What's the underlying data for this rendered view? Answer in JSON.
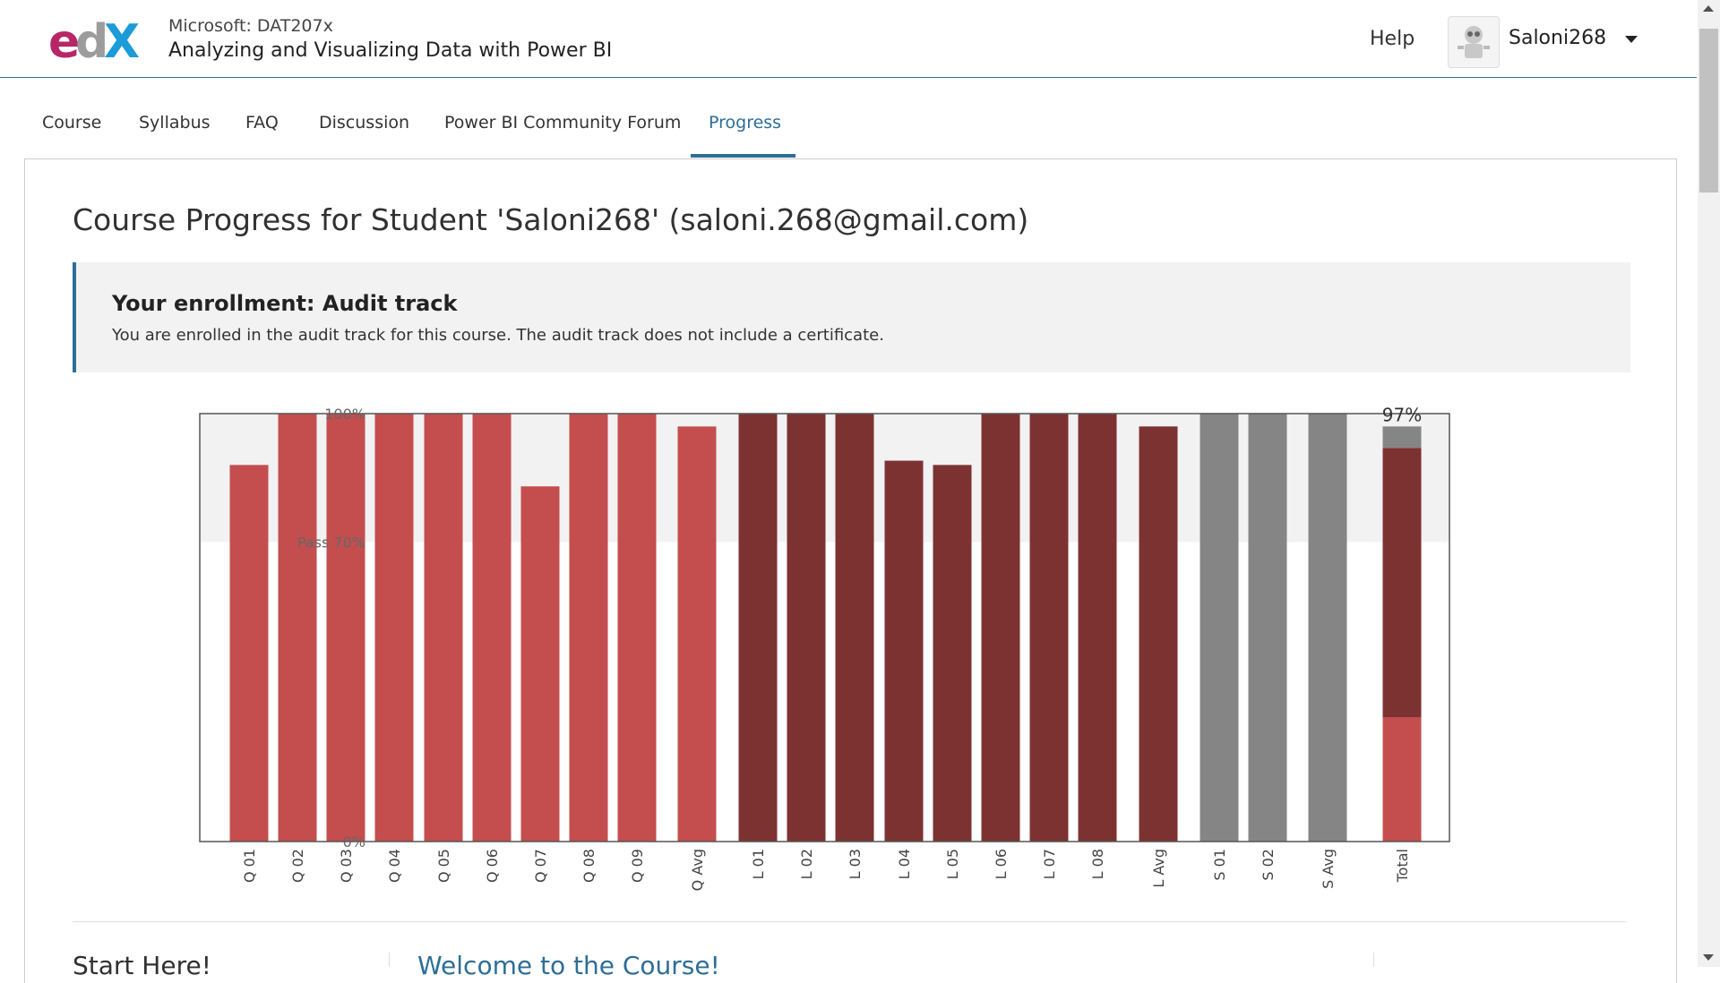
{
  "header": {
    "logo_text": "edX",
    "course_org": "Microsoft: DAT207x",
    "course_name": "Analyzing and Visualizing Data with Power BI",
    "help_label": "Help",
    "username": "Saloni268"
  },
  "tabs": [
    {
      "label": "Course"
    },
    {
      "label": "Syllabus"
    },
    {
      "label": "FAQ"
    },
    {
      "label": "Discussion"
    },
    {
      "label": "Power BI Community Forum"
    },
    {
      "label": "Progress",
      "active": true
    }
  ],
  "main": {
    "page_title": "Course Progress for Student 'Saloni268' (saloni.268@gmail.com)",
    "enrollment": {
      "title": "Your enrollment: Audit track",
      "text": "You are enrolled in the audit track for this course. The audit track does not include a certificate."
    },
    "sidebar_heading": "Start Here!",
    "welcome_link": "Welcome to the Course!"
  },
  "chart_data": {
    "type": "bar",
    "ylim": [
      0,
      100
    ],
    "pass_threshold": 70,
    "tick_labels": {
      "top": "100%",
      "pass": "Pass 70%",
      "bottom": "0%"
    },
    "total_label": "97%",
    "categories": [
      "Q 01",
      "Q 02",
      "Q 03",
      "Q 04",
      "Q 05",
      "Q 06",
      "Q 07",
      "Q 08",
      "Q 09",
      "Q Avg",
      "L 01",
      "L 02",
      "L 03",
      "L 04",
      "L 05",
      "L 06",
      "L 07",
      "L 08",
      "L Avg",
      "S 01",
      "S 02",
      "S Avg",
      "Total"
    ],
    "bars": [
      {
        "label": "Q 01",
        "value": 88,
        "group": "quiz"
      },
      {
        "label": "Q 02",
        "value": 100,
        "group": "quiz"
      },
      {
        "label": "Q 03",
        "value": 100,
        "group": "quiz"
      },
      {
        "label": "Q 04",
        "value": 100,
        "group": "quiz"
      },
      {
        "label": "Q 05",
        "value": 100,
        "group": "quiz"
      },
      {
        "label": "Q 06",
        "value": 100,
        "group": "quiz"
      },
      {
        "label": "Q 07",
        "value": 83,
        "group": "quiz"
      },
      {
        "label": "Q 08",
        "value": 100,
        "group": "quiz"
      },
      {
        "label": "Q 09",
        "value": 100,
        "group": "quiz"
      },
      {
        "label": "Q Avg",
        "value": 97,
        "group": "quiz"
      },
      {
        "label": "L 01",
        "value": 100,
        "group": "lab"
      },
      {
        "label": "L 02",
        "value": 100,
        "group": "lab"
      },
      {
        "label": "L 03",
        "value": 100,
        "group": "lab"
      },
      {
        "label": "L 04",
        "value": 89,
        "group": "lab"
      },
      {
        "label": "L 05",
        "value": 88,
        "group": "lab"
      },
      {
        "label": "L 06",
        "value": 100,
        "group": "lab"
      },
      {
        "label": "L 07",
        "value": 100,
        "group": "lab"
      },
      {
        "label": "L 08",
        "value": 100,
        "group": "lab"
      },
      {
        "label": "L Avg",
        "value": 97,
        "group": "lab"
      },
      {
        "label": "S 01",
        "value": 100,
        "group": "survey"
      },
      {
        "label": "S 02",
        "value": 100,
        "group": "survey"
      },
      {
        "label": "S Avg",
        "value": 100,
        "group": "survey"
      }
    ],
    "total_stack": [
      {
        "group": "quiz",
        "value": 29
      },
      {
        "group": "lab",
        "value": 63
      },
      {
        "group": "survey",
        "value": 5
      }
    ],
    "colors": {
      "quiz": "#c44e4e",
      "lab": "#7d3232",
      "survey": "#858585",
      "pass_zone": "#f2f2f2"
    }
  }
}
